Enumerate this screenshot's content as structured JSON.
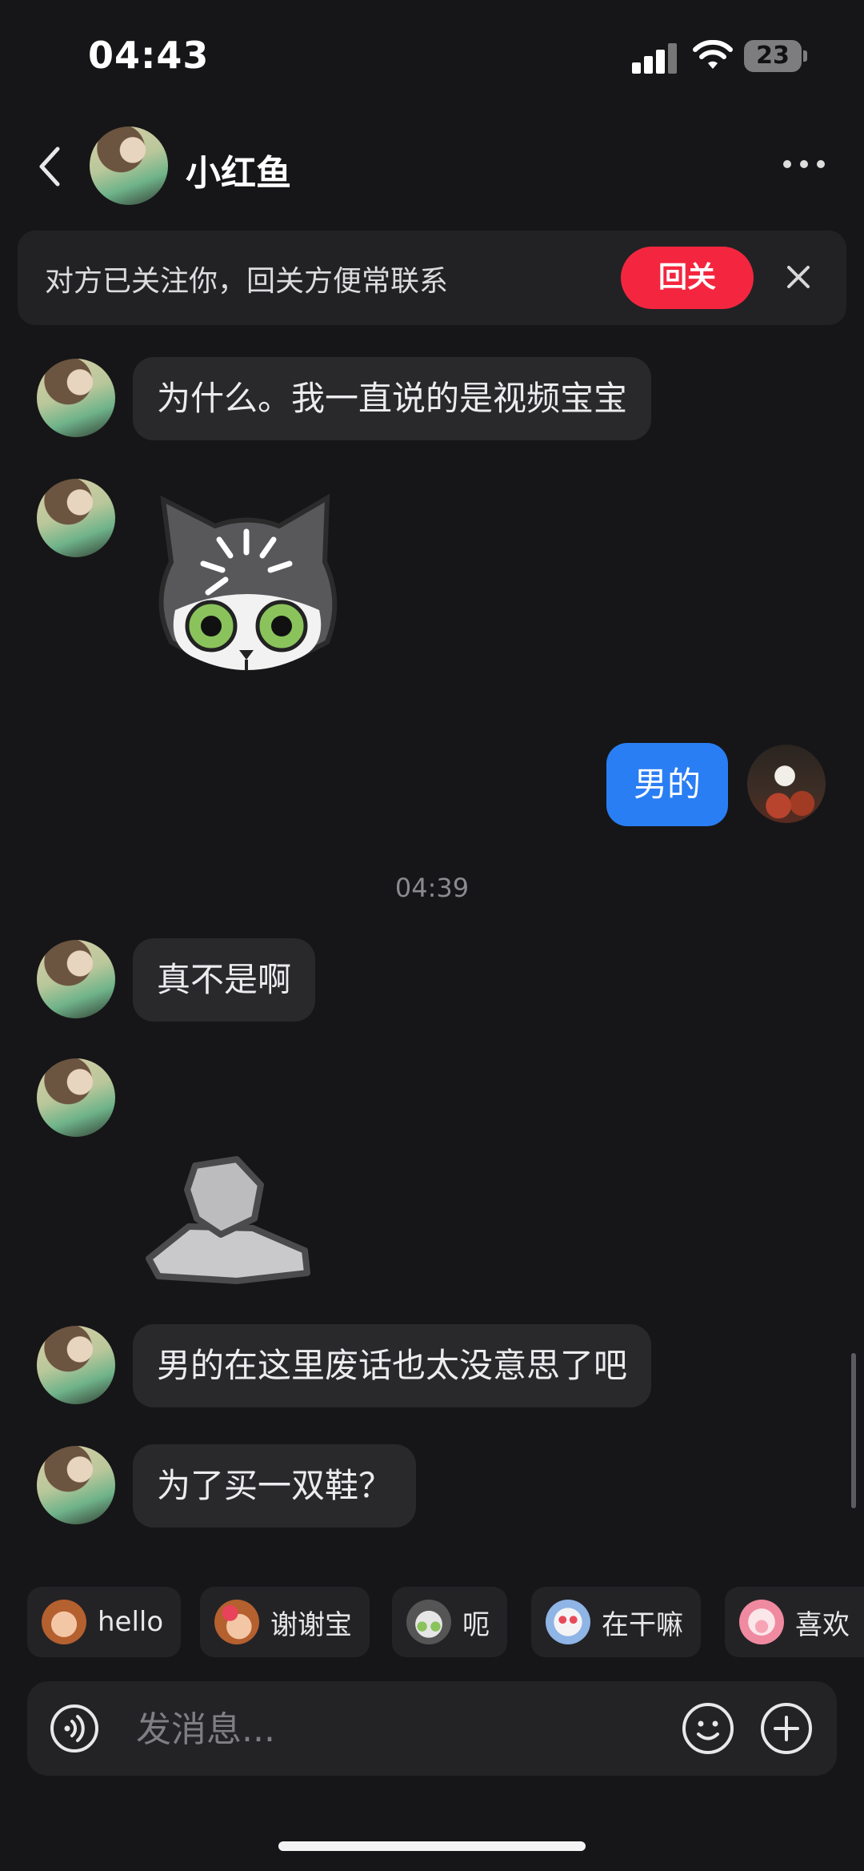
{
  "status_bar": {
    "time": "04:43",
    "battery": "23"
  },
  "header": {
    "contact_name": "小红鱼",
    "back_icon": "chevron-left-icon",
    "more_icon": "more-icon"
  },
  "banner": {
    "text": "对方已关注你，回关方便常联系",
    "follow_label": "回关",
    "close_icon": "close-icon"
  },
  "messages": [
    {
      "from": "them",
      "type": "text",
      "text": "为什么。我一直说的是视频宝宝"
    },
    {
      "from": "them",
      "type": "sticker",
      "sticker": "shocked-cat-sticker"
    },
    {
      "from": "me",
      "type": "text",
      "text": "男的"
    },
    {
      "type": "timestamp",
      "text": "04:39"
    },
    {
      "from": "them",
      "type": "text",
      "text": "真不是啊"
    },
    {
      "from": "them",
      "type": "sticker",
      "sticker": "rock-sticker"
    },
    {
      "from": "them",
      "type": "text",
      "text": "男的在这里废话也太没意思了吧"
    },
    {
      "from": "them",
      "type": "text",
      "text": "为了买一双鞋？"
    }
  ],
  "quick_replies": [
    {
      "label": "hello",
      "icon": "monkey-emoji-icon"
    },
    {
      "label": "谢谢宝",
      "icon": "monkey-flower-emoji-icon"
    },
    {
      "label": "呃",
      "icon": "cat-emoji-icon"
    },
    {
      "label": "在干嘛",
      "icon": "ghost-emoji-icon"
    },
    {
      "label": "喜欢",
      "icon": "pig-emoji-icon"
    }
  ],
  "input": {
    "placeholder": "发消息..."
  },
  "colors": {
    "follow_button": "#f4263f",
    "my_bubble": "#2a7ef4",
    "background": "#161618"
  }
}
